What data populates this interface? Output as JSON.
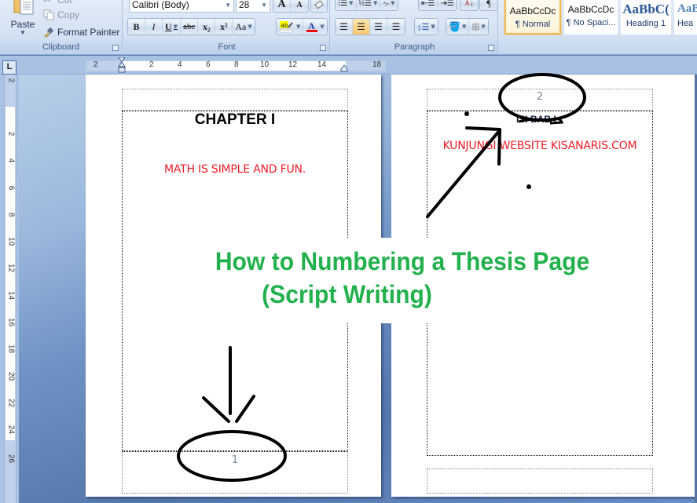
{
  "ribbon": {
    "clipboard": {
      "label": "Clipboard",
      "paste_label": "Paste",
      "cut_label": "Cut",
      "copy_label": "Copy",
      "format_painter_label": "Format Painter"
    },
    "font": {
      "label": "Font",
      "font_name": "Calibri (Body)",
      "font_size": "28",
      "grow_font": "A",
      "shrink_font": "A",
      "bold": "B",
      "italic": "I",
      "underline": "U",
      "strikethrough": "abc",
      "subscript": "x₂",
      "superscript": "x²",
      "change_case": "Aa",
      "highlight_color": "#ffff00",
      "font_color": "#ff0000"
    },
    "paragraph": {
      "label": "Paragraph",
      "active_alignment": "center"
    },
    "styles": {
      "items": [
        {
          "sample": "AaBbCcDc",
          "name": "¶ Normal",
          "selected": true
        },
        {
          "sample": "AaBbCcDc",
          "name": "¶ No Spaci...",
          "selected": false
        },
        {
          "sample": "AaBbC(",
          "name": "Heading 1",
          "selected": false
        },
        {
          "sample": "AaB",
          "name": "Hea",
          "selected": false
        }
      ]
    }
  },
  "ruler": {
    "horizontal_labels": [
      "2",
      "2",
      "4",
      "6",
      "8",
      "10",
      "12",
      "14",
      "18"
    ],
    "vertical_labels": [
      "2",
      "2",
      "4",
      "6",
      "8",
      "10",
      "12",
      "14",
      "16",
      "18",
      "20",
      "22",
      "24",
      "26"
    ]
  },
  "document": {
    "page1": {
      "heading": "CHAPTER I",
      "subtext": "MATH IS SIMPLE AND FUN.",
      "footer_page_number": "1"
    },
    "page2": {
      "header_page_number": "2",
      "heading_obscured": "ISI BAB I",
      "subtext": "KUNJUNGI WEBSITE KISANARIS.COM"
    },
    "overlay": {
      "title_line1": "How to Numbering a Thesis Page",
      "title_line2": "(Script Writing)",
      "color": "#22b14c"
    },
    "text_color_red": "#ee1c24"
  }
}
